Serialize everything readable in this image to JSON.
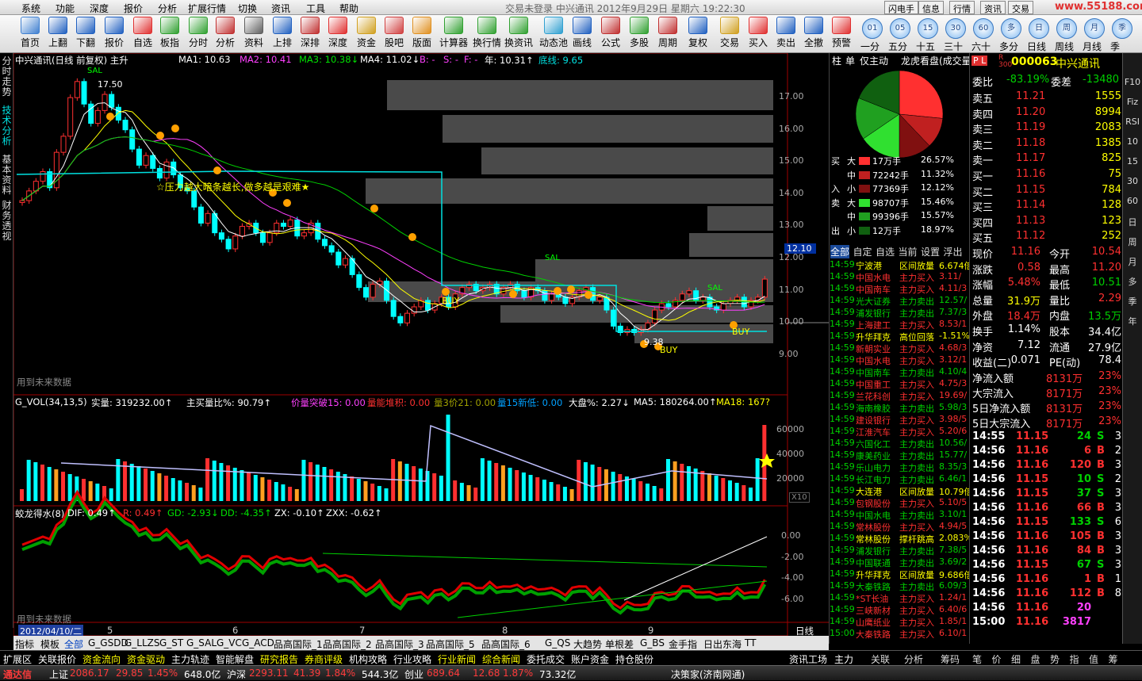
{
  "app": {
    "title": "交易未登录  中兴通讯  2012年9月29日  星期六  19:22:30"
  },
  "menu": [
    "系统",
    "功能",
    "深度",
    "报价",
    "分析",
    "扩展行情",
    "切换",
    "资讯",
    "工具",
    "帮助"
  ],
  "menu_right": [
    "闪电手",
    "信息",
    "行情",
    "资讯",
    "交易"
  ],
  "brand": "www.55188.com",
  "toolbar": [
    {
      "label": "首页",
      "icon": "home-icon",
      "color": "#4080d0"
    },
    {
      "label": "上翻",
      "icon": "up-arrow-icon",
      "color": "#2060c0"
    },
    {
      "label": "下翻",
      "icon": "down-arrow-icon",
      "color": "#2060c0"
    },
    {
      "label": "报价",
      "icon": "yen-icon",
      "color": "#2060c0"
    },
    {
      "label": "自选",
      "icon": "f6-icon",
      "color": "#e03030"
    },
    {
      "label": "板指",
      "icon": "pie-icon",
      "color": "#30a030"
    },
    {
      "label": "分时",
      "icon": "chart-line-icon",
      "color": "#30a030"
    },
    {
      "label": "分析",
      "icon": "candle-icon",
      "color": "#c03030"
    },
    {
      "label": "资料",
      "icon": "book-icon",
      "color": "#606060"
    },
    {
      "label": "上排",
      "icon": "list-icon",
      "color": "#2060c0"
    },
    {
      "label": "深排",
      "icon": "sz-list-icon",
      "color": "#c03030"
    },
    {
      "label": "深度",
      "icon": "f9-icon",
      "color": "#e03030"
    },
    {
      "label": "资金",
      "icon": "coins-icon",
      "color": "#d0a020"
    },
    {
      "label": "股吧",
      "icon": "people-icon",
      "color": "#d04040"
    },
    {
      "label": "版面",
      "icon": "l2-icon",
      "color": "#e09020"
    },
    {
      "label": "计算器",
      "icon": "calculator-icon",
      "color": "#30a030"
    },
    {
      "label": "换行情",
      "icon": "monitor-icon",
      "color": "#30a030"
    },
    {
      "label": "换资讯",
      "icon": "monitor-info-icon",
      "color": "#30a030"
    },
    {
      "label": "动态池",
      "icon": "pool-icon",
      "color": "#30a0d0"
    },
    {
      "label": "画线",
      "icon": "draw-icon",
      "color": "#2060c0"
    },
    {
      "label": "公式",
      "icon": "formula-icon",
      "color": "#c03030"
    },
    {
      "label": "多股",
      "icon": "multi-chart-icon",
      "color": "#30a030"
    },
    {
      "label": "周期",
      "icon": "calendar-icon",
      "color": "#c03030"
    },
    {
      "label": "复权",
      "icon": "restore-icon",
      "color": "#2060c0"
    },
    {
      "label": "交易",
      "icon": "trade-icon",
      "color": "#d0a020"
    },
    {
      "label": "买入",
      "icon": "buy-icon",
      "color": "#e03030"
    },
    {
      "label": "卖出",
      "icon": "sell-icon",
      "color": "#2060c0"
    },
    {
      "label": "全撤",
      "icon": "cancel-all-icon",
      "color": "#2060c0"
    },
    {
      "label": "预警",
      "icon": "alarm-icon",
      "color": "#e03030"
    }
  ],
  "periods": [
    {
      "num": "01",
      "label": "一分"
    },
    {
      "num": "05",
      "label": "五分"
    },
    {
      "num": "15",
      "label": "十五"
    },
    {
      "num": "30",
      "label": "三十"
    },
    {
      "num": "60",
      "label": "六十"
    },
    {
      "num": "多",
      "label": "多分"
    },
    {
      "num": "日",
      "label": "日线"
    },
    {
      "num": "周",
      "label": "周线"
    },
    {
      "num": "月",
      "label": "月线"
    },
    {
      "num": "季",
      "label": "季"
    }
  ],
  "left_tabs": [
    "分时走势",
    "技术分析",
    "基本资料",
    "财务透视"
  ],
  "main": {
    "title": "中兴通讯(日线 前复权) 主升",
    "ma": [
      {
        "label": "MA1: 10.63",
        "color": "#ffffff"
      },
      {
        "label": "MA2: 10.41",
        "color": "#ff40ff"
      },
      {
        "label": "MA3: 10.38↓",
        "color": "#00e000"
      },
      {
        "label": "MA4: 11.02↓",
        "color": "#ffffff"
      },
      {
        "label": "B: -",
        "color": "#ff40ff"
      },
      {
        "label": "S: -",
        "color": "#ff40ff"
      },
      {
        "label": "F: -",
        "color": "#ff40ff"
      },
      {
        "label": "年: 10.31↑",
        "color": "#ffffff"
      },
      {
        "label": "底线: 9.65",
        "color": "#00e0e0"
      }
    ],
    "y_ticks": [
      "17.00",
      "16.00",
      "15.00",
      "14.00",
      "13.00",
      "12.00",
      "11.00",
      "10.00",
      "9.00"
    ],
    "price_tag": "12.10",
    "annotation": "☆压力越大暗条越长,做多越是艰难★",
    "hi_label": "17.50",
    "lo_label": "9.38",
    "future_text": "用到未来数据",
    "markers": [
      "SAL",
      "SAL",
      "SAL",
      "BUY",
      "BUY",
      "BUY"
    ]
  },
  "vol": {
    "title": "G_VOL(34,13,5)",
    "parts": [
      {
        "t": "实量: 319232.00↑",
        "c": "#ffffff"
      },
      {
        "t": "主买量比%: 90.79↑",
        "c": "#ffffff"
      },
      {
        "t": "价量突破15: 0.00",
        "c": "#ff40ff"
      },
      {
        "t": "量能堆积: 0.00",
        "c": "#ff3030"
      },
      {
        "t": "量3价21: 0.00",
        "c": "#a0a000"
      },
      {
        "t": "量15新低: 0.00",
        "c": "#00a0ff"
      },
      {
        "t": "大盘%: 2.27↓",
        "c": "#ffffff"
      },
      {
        "t": "MA5: 180264.00↑",
        "c": "#ffffff"
      },
      {
        "t": "MA18: 167?",
        "c": "#ffff00"
      }
    ],
    "y_ticks": [
      "60000",
      "40000",
      "20000"
    ],
    "scale": "X10"
  },
  "macd": {
    "title": "蛟龙得水(8)",
    "parts": [
      {
        "t": "DIF: 0.49↑",
        "c": "#ffffff"
      },
      {
        "t": "R: 0.49↑",
        "c": "#ff3030"
      },
      {
        "t": "GD: -2.93↓",
        "c": "#00e000"
      },
      {
        "t": "DD: -4.35↑",
        "c": "#00e000"
      },
      {
        "t": "ZX: -0.10↑",
        "c": "#ffffff"
      },
      {
        "t": "ZXX: -0.62↑",
        "c": "#ffffff"
      }
    ],
    "y_ticks": [
      "0.00",
      "-2.00",
      "-4.00",
      "-6.00"
    ],
    "future_text": "用到未来数据"
  },
  "x_axis": {
    "date": "2012/04/10/二",
    "months": [
      "5",
      "6",
      "7",
      "8",
      "9"
    ],
    "period": "日线"
  },
  "pie": {
    "header": [
      "柱",
      "单",
      "仅主动",
      "龙虎看盘(成交量比"
    ],
    "slices": [
      26.57,
      11.32,
      12.12,
      15.46,
      15.57,
      18.97
    ]
  },
  "flow": [
    {
      "side": "买",
      "size": "大",
      "val": "17万手",
      "pct": "26.57%",
      "color": "#ff3030"
    },
    {
      "side": "",
      "size": "中",
      "val": "72242手",
      "pct": "11.32%",
      "color": "#c02020"
    },
    {
      "side": "入",
      "size": "小",
      "val": "77369手",
      "pct": "12.12%",
      "color": "#801010"
    },
    {
      "side": "卖",
      "size": "大",
      "val": "98707手",
      "pct": "15.46%",
      "color": "#30e030"
    },
    {
      "side": "",
      "size": "中",
      "val": "99396手",
      "pct": "15.57%",
      "color": "#20a020"
    },
    {
      "side": "出",
      "size": "小",
      "val": "12万手",
      "pct": "18.97%",
      "color": "#106010"
    }
  ],
  "radar_tabs": [
    "全部",
    "自定",
    "自选",
    "当前",
    "设置",
    "浮出"
  ],
  "radar": [
    [
      "14:59",
      "宁波港",
      "区间放量",
      "6.674倍",
      "#ffff00",
      "#ffff00"
    ],
    [
      "14:59",
      "中国水电",
      "主力买入",
      "3.11/",
      "#ff3030",
      "#ff3030"
    ],
    [
      "14:59",
      "中国南车",
      "主力买入",
      "4.11/3",
      "#ff3030",
      "#ff3030"
    ],
    [
      "14:59",
      "光大证券",
      "主力卖出",
      "12.57/",
      "#00d000",
      "#00d000"
    ],
    [
      "14:59",
      "浦发银行",
      "主力卖出",
      "7.37/3",
      "#00d000",
      "#00d000"
    ],
    [
      "14:59",
      "上海建工",
      "主力买入",
      "8.53/1",
      "#ff3030",
      "#ff3030"
    ],
    [
      "14:59",
      "升华拜克",
      "高位回落",
      "-1.51%",
      "#ffff00",
      "#ffff00"
    ],
    [
      "14:59",
      "新朝实业",
      "主力买入",
      "4.68/3",
      "#ff3030",
      "#ff3030"
    ],
    [
      "14:59",
      "中国水电",
      "主力买入",
      "3.12/1",
      "#ff3030",
      "#ff3030"
    ],
    [
      "14:59",
      "中国南车",
      "主力卖出",
      "4.10/4",
      "#00d000",
      "#00d000"
    ],
    [
      "14:59",
      "中国重工",
      "主力买入",
      "4.75/3",
      "#ff3030",
      "#ff3030"
    ],
    [
      "14:59",
      "兰花科创",
      "主力买入",
      "19.69/",
      "#ff3030",
      "#ff3030"
    ],
    [
      "14:59",
      "海南橡胶",
      "主力卖出",
      "5.98/3",
      "#00d000",
      "#00d000"
    ],
    [
      "14:59",
      "建设银行",
      "主力买入",
      "3.98/5",
      "#ff3030",
      "#ff3030"
    ],
    [
      "14:59",
      "江淮汽车",
      "主力买入",
      "5.20/6",
      "#ff3030",
      "#ff3030"
    ],
    [
      "14:59",
      "六国化工",
      "主力卖出",
      "10.56/",
      "#00d000",
      "#00d000"
    ],
    [
      "14:59",
      "康美药业",
      "主力卖出",
      "15.77/",
      "#00d000",
      "#00d000"
    ],
    [
      "14:59",
      "乐山电力",
      "主力卖出",
      "8.35/3",
      "#00d000",
      "#00d000"
    ],
    [
      "14:59",
      "长江电力",
      "主力卖出",
      "6.46/1",
      "#00d000",
      "#00d000"
    ],
    [
      "14:59",
      "大连港",
      "区间放量",
      "10.79倍",
      "#ffff00",
      "#ffff00"
    ],
    [
      "14:59",
      "包钢股份",
      "主力买入",
      "5.10/5",
      "#ff3030",
      "#ff3030"
    ],
    [
      "14:59",
      "中国水电",
      "主力卖出",
      "3.10/1",
      "#00d000",
      "#00d000"
    ],
    [
      "14:59",
      "常林股份",
      "主力买入",
      "4.94/5",
      "#ff3030",
      "#ff3030"
    ],
    [
      "14:59",
      "常林股份",
      "撑杆跳高",
      "2.083%",
      "#ffff00",
      "#ffff00"
    ],
    [
      "14:59",
      "浦发银行",
      "主力卖出",
      "7.38/5",
      "#00d000",
      "#00d000"
    ],
    [
      "14:59",
      "中国联通",
      "主力卖出",
      "3.69/2",
      "#00d000",
      "#00d000"
    ],
    [
      "14:59",
      "升华拜克",
      "区间放量",
      "9.686倍",
      "#ffff00",
      "#ffff00"
    ],
    [
      "14:59",
      "大秦铁路",
      "主力卖出",
      "6.09/3",
      "#00d000",
      "#00d000"
    ],
    [
      "14:59",
      "*ST长油",
      "主力买入",
      "1.24/1",
      "#ff3030",
      "#ff3030"
    ],
    [
      "14:59",
      "三峡新材",
      "主力买入",
      "6.40/6",
      "#ff3030",
      "#ff3030"
    ],
    [
      "14:59",
      "山鹰纸业",
      "主力买入",
      "1.85/1",
      "#ff3030",
      "#ff3030"
    ],
    [
      "15:00",
      "大秦铁路",
      "主力买入",
      "6.10/1",
      "#ff3030",
      "#ff3030"
    ]
  ],
  "quote": {
    "code": "000063",
    "name": "中兴通讯",
    "pl": "P L",
    "r": "R 300",
    "wb": "委比",
    "wb_val": "-83.19%",
    "wc": "委差",
    "wc_val": "-13480",
    "asks": [
      [
        "卖五",
        "11.21",
        "1555"
      ],
      [
        "卖四",
        "11.20",
        "8994"
      ],
      [
        "卖三",
        "11.19",
        "2083"
      ],
      [
        "卖二",
        "11.18",
        "1385"
      ],
      [
        "卖一",
        "11.17",
        "825"
      ]
    ],
    "bids": [
      [
        "买一",
        "11.16",
        "75"
      ],
      [
        "买二",
        "11.15",
        "784"
      ],
      [
        "买三",
        "11.14",
        "128"
      ],
      [
        "买四",
        "11.13",
        "123"
      ],
      [
        "买五",
        "11.12",
        "252"
      ]
    ],
    "stats": [
      [
        "现价",
        "11.16",
        "#ff3030",
        "今开",
        "10.54",
        "#ff3030"
      ],
      [
        "涨跌",
        "0.58",
        "#ff3030",
        "最高",
        "11.20",
        "#ff3030"
      ],
      [
        "涨幅",
        "5.48%",
        "#ff3030",
        "最低",
        "10.51",
        "#00d000"
      ],
      [
        "总量",
        "31.9万",
        "#ffff00",
        "量比",
        "2.29",
        "#ff3030"
      ],
      [
        "外盘",
        "18.4万",
        "#ff3030",
        "内盘",
        "13.5万",
        "#00d000"
      ],
      [
        "换手",
        "1.14%",
        "#ffffff",
        "股本",
        "34.4亿",
        "#ffffff"
      ],
      [
        "净资",
        "7.12",
        "#ffffff",
        "流通",
        "27.9亿",
        "#ffffff"
      ],
      [
        "收益(二)",
        "0.071",
        "#ffffff",
        "PE(动)",
        "78.4",
        "#ffffff"
      ]
    ],
    "funds": [
      [
        "净流入额",
        "8131万",
        "23%"
      ],
      [
        "大宗流入",
        "8171万",
        "23%"
      ],
      [
        "5日净流入额",
        "8131万",
        "23%"
      ],
      [
        "5日大宗流入",
        "8171万",
        "23%"
      ]
    ],
    "ticks": [
      [
        "14:55",
        "11.15",
        "24",
        "S",
        "3"
      ],
      [
        "14:56",
        "11.16",
        "6",
        "B",
        "2"
      ],
      [
        "14:56",
        "11.16",
        "120",
        "B",
        "3"
      ],
      [
        "14:56",
        "11.15",
        "10",
        "S",
        "2"
      ],
      [
        "14:56",
        "11.15",
        "37",
        "S",
        "3"
      ],
      [
        "14:56",
        "11.16",
        "66",
        "B",
        "3"
      ],
      [
        "14:56",
        "11.15",
        "133",
        "S",
        "6"
      ],
      [
        "14:56",
        "11.16",
        "105",
        "B",
        "3"
      ],
      [
        "14:56",
        "11.16",
        "84",
        "B",
        "3"
      ],
      [
        "14:56",
        "11.15",
        "67",
        "S",
        "3"
      ],
      [
        "14:56",
        "11.16",
        "1",
        "B",
        "1"
      ],
      [
        "14:56",
        "11.16",
        "112",
        "B",
        "8"
      ],
      [
        "14:56",
        "11.16",
        "20",
        "",
        ""
      ],
      [
        "15:00",
        "11.16",
        "3817",
        "",
        ""
      ]
    ]
  },
  "right_bar": [
    "F10",
    "Fiz",
    "RSI",
    "10",
    "15",
    "30",
    "60",
    "日",
    "周",
    "月",
    "多",
    "季",
    "年"
  ],
  "bottom_tabs": [
    "指标",
    "模板",
    "全部",
    "G_GSDD",
    "G_LLZS",
    "G_ST",
    "G_SAL",
    "G_VC",
    "G_ACD",
    "品高国际_1",
    "品高国际_2",
    "品高国际_3",
    "品高国际_5",
    "品高国际_6",
    "G_QS",
    "大趋势",
    "单根差",
    "G_BS",
    "金手指",
    "日出东海",
    "TT"
  ],
  "func_tabs": [
    "扩展区",
    "关联报价",
    "资金流向",
    "资金驱动",
    "主力轨迹",
    "智能解盘",
    "研究报告",
    "券商评级",
    "机构攻略",
    "行业攻略",
    "行业新闻",
    "综合新闻",
    "委托成交",
    "账户资金",
    "持仓股份",
    "资讯工场"
  ],
  "quote_tabs": [
    "主力",
    "关联",
    "分析",
    "筹码"
  ],
  "right_icons": [
    "笔",
    "价",
    "细",
    "盘",
    "势",
    "指",
    "值",
    "筹"
  ],
  "status": {
    "brand": "通达信",
    "sh_label": "上证",
    "sh": "2086.17",
    "sh_chg": "29.85",
    "sh_pct": "1.45%",
    "sh_amt": "648.0亿",
    "sz_label": "沪深",
    "sz": "2293.11",
    "sz_chg": "41.39",
    "sz_pct": "1.84%",
    "sz_amt": "544.3亿",
    "cy_label": "创业",
    "cy": "689.64",
    "cy_chg": "12.68",
    "cy_pct": "1.87%",
    "cy_amt": "73.32亿",
    "server": "决策家(济南网通)"
  }
}
